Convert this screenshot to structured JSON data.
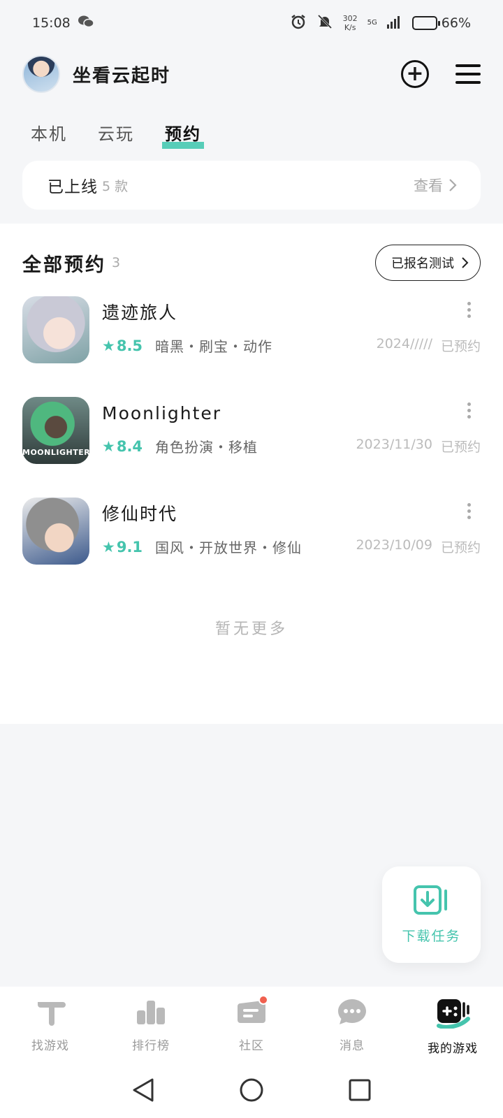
{
  "status_bar": {
    "time": "15:08",
    "speed_value": "302",
    "speed_unit": "K/s",
    "network": "5G",
    "battery_pct": "66%",
    "battery_level": 0.66
  },
  "header": {
    "username": "坐看云起时"
  },
  "tabs": [
    {
      "label": "本机",
      "active": false
    },
    {
      "label": "云玩",
      "active": false
    },
    {
      "label": "预约",
      "active": true
    }
  ],
  "released": {
    "label": "已上线",
    "count": "5 款",
    "view_label": "查看"
  },
  "reservations": {
    "title": "全部预约",
    "count": "3",
    "test_button": "已报名测试",
    "games": [
      {
        "name": "遗迹旅人",
        "rating": "8.5",
        "tags": "暗黑・刷宝・动作",
        "date": "2024/////",
        "status": "已预约"
      },
      {
        "name": "Moonlighter",
        "icon_text": "MOONLIGHTER",
        "rating": "8.4",
        "tags": "角色扮演・移植",
        "date": "2023/11/30",
        "status": "已预约"
      },
      {
        "name": "修仙时代",
        "rating": "9.1",
        "tags": "国风・开放世界・修仙",
        "date": "2023/10/09",
        "status": "已预约"
      }
    ],
    "no_more": "暂无更多"
  },
  "download_fab": {
    "label": "下载任务"
  },
  "bottom_nav": [
    {
      "label": "找游戏",
      "icon": "find-game-icon"
    },
    {
      "label": "排行榜",
      "icon": "ranking-icon"
    },
    {
      "label": "社区",
      "icon": "community-icon"
    },
    {
      "label": "消息",
      "icon": "message-icon"
    },
    {
      "label": "我的游戏",
      "icon": "my-games-icon"
    }
  ],
  "colors": {
    "accent": "#45c4ad",
    "badge": "#f0604f"
  }
}
